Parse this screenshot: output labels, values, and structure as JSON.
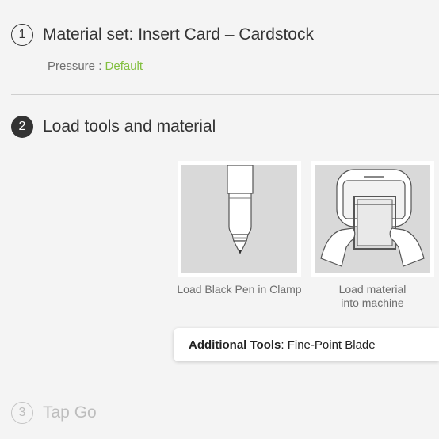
{
  "step1": {
    "number": "1",
    "title": "Material set: Insert Card –  Cardstock",
    "pressure_label": "Pressure :",
    "pressure_value": "Default"
  },
  "step2": {
    "number": "2",
    "title": "Load tools and material",
    "cards": [
      {
        "caption": "Load Black Pen in Clamp",
        "image": "black-pen-illustration"
      },
      {
        "caption_line1": "Load material",
        "caption_line2": "into machine",
        "image": "machine-loading-illustration"
      }
    ],
    "additional_tools_label": "Additional Tools",
    "additional_tools_value": ": Fine-Point Blade"
  },
  "step3": {
    "number": "3",
    "title": "Tap Go"
  },
  "colors": {
    "background": "#f4f4f4",
    "accent_green": "#82bf3f",
    "active_step": "#333333",
    "inactive_step": "#bdbdbd"
  }
}
